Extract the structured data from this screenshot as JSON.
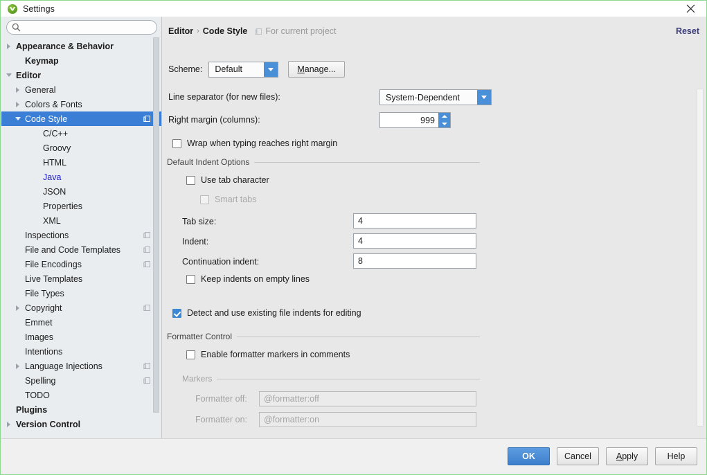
{
  "window": {
    "title": "Settings",
    "app_icon": "intellij-logo-icon",
    "close_icon": "close-icon"
  },
  "sidebar": {
    "search": {
      "value": "",
      "placeholder": "",
      "icon": "search-icon"
    },
    "items": [
      {
        "label": "Appearance & Behavior",
        "indent": 0,
        "arrow": "collapsed",
        "bold": true,
        "badge": false,
        "selected": false
      },
      {
        "label": "Keymap",
        "indent": 1,
        "arrow": "none",
        "bold": true,
        "badge": false,
        "selected": false
      },
      {
        "label": "Editor",
        "indent": 0,
        "arrow": "expanded",
        "bold": true,
        "badge": false,
        "selected": false
      },
      {
        "label": "General",
        "indent": 1,
        "arrow": "collapsed",
        "bold": false,
        "badge": false,
        "selected": false
      },
      {
        "label": "Colors & Fonts",
        "indent": 1,
        "arrow": "collapsed",
        "bold": false,
        "badge": false,
        "selected": false
      },
      {
        "label": "Code Style",
        "indent": 1,
        "arrow": "expanded",
        "bold": false,
        "badge": true,
        "selected": true
      },
      {
        "label": "C/C++",
        "indent": 3,
        "arrow": "none",
        "bold": false,
        "badge": false,
        "selected": false
      },
      {
        "label": "Groovy",
        "indent": 3,
        "arrow": "none",
        "bold": false,
        "badge": false,
        "selected": false
      },
      {
        "label": "HTML",
        "indent": 3,
        "arrow": "none",
        "bold": false,
        "badge": false,
        "selected": false
      },
      {
        "label": "Java",
        "indent": 3,
        "arrow": "none",
        "bold": false,
        "badge": false,
        "selected": false,
        "link": true
      },
      {
        "label": "JSON",
        "indent": 3,
        "arrow": "none",
        "bold": false,
        "badge": false,
        "selected": false
      },
      {
        "label": "Properties",
        "indent": 3,
        "arrow": "none",
        "bold": false,
        "badge": false,
        "selected": false
      },
      {
        "label": "XML",
        "indent": 3,
        "arrow": "none",
        "bold": false,
        "badge": false,
        "selected": false
      },
      {
        "label": "Inspections",
        "indent": 1,
        "arrow": "none",
        "bold": false,
        "badge": true,
        "selected": false
      },
      {
        "label": "File and Code Templates",
        "indent": 1,
        "arrow": "none",
        "bold": false,
        "badge": true,
        "selected": false
      },
      {
        "label": "File Encodings",
        "indent": 1,
        "arrow": "none",
        "bold": false,
        "badge": true,
        "selected": false
      },
      {
        "label": "Live Templates",
        "indent": 1,
        "arrow": "none",
        "bold": false,
        "badge": false,
        "selected": false
      },
      {
        "label": "File Types",
        "indent": 1,
        "arrow": "none",
        "bold": false,
        "badge": false,
        "selected": false
      },
      {
        "label": "Copyright",
        "indent": 1,
        "arrow": "collapsed",
        "bold": false,
        "badge": true,
        "selected": false
      },
      {
        "label": "Emmet",
        "indent": 1,
        "arrow": "none",
        "bold": false,
        "badge": false,
        "selected": false
      },
      {
        "label": "Images",
        "indent": 1,
        "arrow": "none",
        "bold": false,
        "badge": false,
        "selected": false
      },
      {
        "label": "Intentions",
        "indent": 1,
        "arrow": "none",
        "bold": false,
        "badge": false,
        "selected": false
      },
      {
        "label": "Language Injections",
        "indent": 1,
        "arrow": "collapsed",
        "bold": false,
        "badge": true,
        "selected": false
      },
      {
        "label": "Spelling",
        "indent": 1,
        "arrow": "none",
        "bold": false,
        "badge": true,
        "selected": false
      },
      {
        "label": "TODO",
        "indent": 1,
        "arrow": "none",
        "bold": false,
        "badge": false,
        "selected": false
      },
      {
        "label": "Plugins",
        "indent": 0,
        "arrow": "none",
        "bold": true,
        "badge": false,
        "selected": false
      },
      {
        "label": "Version Control",
        "indent": 0,
        "arrow": "collapsed",
        "bold": true,
        "badge": false,
        "selected": false
      }
    ]
  },
  "content": {
    "breadcrumb": {
      "parent": "Editor",
      "separator": "›",
      "current": "Code Style"
    },
    "scope_badge": {
      "icon": "project-scope-icon",
      "text": "For current project"
    },
    "reset_label": "Reset",
    "scheme": {
      "label": "Scheme:",
      "value": "Default",
      "manage_label": "Manage...",
      "manage_mnemonic": "M",
      "manage_rest": "anage..."
    },
    "line_separator": {
      "label": "Line separator (for new files):",
      "value": "System-Dependent"
    },
    "right_margin": {
      "label": "Right margin (columns):",
      "value": "999"
    },
    "wrap_checkbox": {
      "label": "Wrap when typing reaches right margin",
      "checked": false
    },
    "indent_group": {
      "title": "Default Indent Options",
      "use_tab_character": {
        "label": "Use tab character",
        "checked": false,
        "disabled": false
      },
      "smart_tabs": {
        "label": "Smart tabs",
        "checked": false,
        "disabled": true
      },
      "tab_size": {
        "label": "Tab size:",
        "value": "4"
      },
      "indent": {
        "label": "Indent:",
        "value": "4"
      },
      "continuation_indent": {
        "label": "Continuation indent:",
        "value": "8"
      },
      "keep_indents": {
        "label": "Keep indents on empty lines",
        "checked": false
      }
    },
    "detect_indents": {
      "label": "Detect and use existing file indents for editing",
      "checked": true
    },
    "formatter_group": {
      "title": "Formatter Control",
      "enable_markers": {
        "label": "Enable formatter markers in comments",
        "checked": false
      },
      "markers_title": "Markers",
      "formatter_off": {
        "label": "Formatter off:",
        "value": "@formatter:off",
        "disabled": true
      },
      "formatter_on": {
        "label": "Formatter on:",
        "value": "@formatter:on",
        "disabled": true
      }
    }
  },
  "footer": {
    "ok": "OK",
    "cancel": "Cancel",
    "apply_mnemonic": "A",
    "apply_rest": "pply",
    "help": "Help"
  },
  "colors": {
    "accent_blue": "#4a90d9",
    "selection_blue": "#3a7fd5",
    "primary_button": "#3e7fcc",
    "link_navy": "#3b3b7a",
    "java_link": "#2222cc",
    "sidebar_bg": "#e9edf0",
    "content_bg": "#e8e8e8"
  }
}
